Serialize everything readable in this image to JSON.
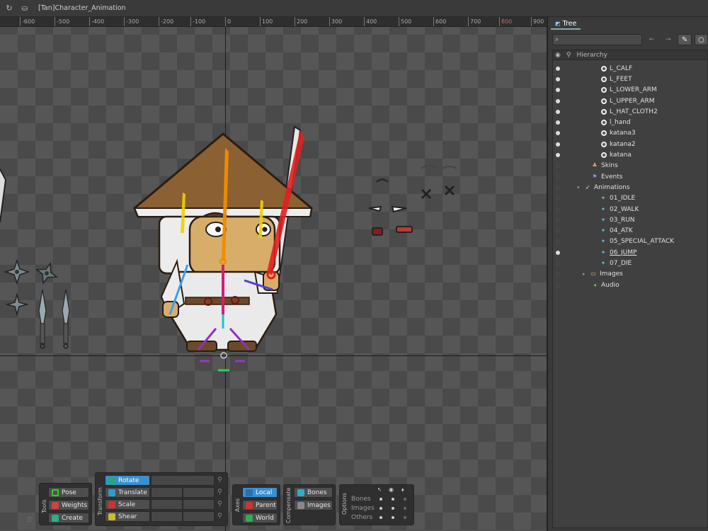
{
  "window": {
    "title": "[Tan]Character_Animation",
    "back_icon": "refresh-icon",
    "doc_icon": "document-icon"
  },
  "ruler": {
    "ticks": [
      "-600",
      "-500",
      "-400",
      "-300",
      "-200",
      "-100",
      "0",
      "100",
      "200",
      "300",
      "400",
      "500",
      "600",
      "700",
      "800",
      "900"
    ]
  },
  "panel": {
    "tab_label": "Tree",
    "search_placeholder": "",
    "header_label": "Hierarchy",
    "tree_items": [
      {
        "label": "L_CALF",
        "kind": "slot",
        "visible": true
      },
      {
        "label": "L_FEET",
        "kind": "slot",
        "visible": true
      },
      {
        "label": "L_LOWER_ARM",
        "kind": "slot",
        "visible": true
      },
      {
        "label": "L_UPPER_ARM",
        "kind": "slot",
        "visible": true
      },
      {
        "label": "L_HAT_CLOTH2",
        "kind": "slot",
        "visible": true
      },
      {
        "label": "l_hand",
        "kind": "slot",
        "visible": true
      },
      {
        "label": "katana3",
        "kind": "slot",
        "visible": true
      },
      {
        "label": "katana2",
        "kind": "slot",
        "visible": true
      },
      {
        "label": "katana",
        "kind": "slot",
        "visible": true
      },
      {
        "label": "Skins",
        "kind": "skins",
        "visible": false
      },
      {
        "label": "Events",
        "kind": "events",
        "visible": false
      },
      {
        "label": "Animations",
        "kind": "animations",
        "visible": false
      },
      {
        "label": "01_IDLE",
        "kind": "animation",
        "visible": false
      },
      {
        "label": "02_WALK",
        "kind": "animation",
        "visible": false
      },
      {
        "label": "03_RUN",
        "kind": "animation",
        "visible": false
      },
      {
        "label": "04_ATK",
        "kind": "animation",
        "visible": false
      },
      {
        "label": "05_SPECIAL_ATTACK",
        "kind": "animation",
        "visible": false
      },
      {
        "label": "06_JUMP",
        "kind": "animation",
        "visible": true
      },
      {
        "label": "07_DIE",
        "kind": "animation",
        "visible": false
      },
      {
        "label": "Images",
        "kind": "images",
        "visible": false
      },
      {
        "label": "Audio",
        "kind": "audio",
        "visible": false
      }
    ]
  },
  "toolbar": {
    "tools": {
      "label": "Tools",
      "pose": "Pose",
      "weights": "Weights",
      "create": "Create"
    },
    "transform": {
      "label": "Transform",
      "rotate": "Rotate",
      "translate": "Translate",
      "scale": "Scale",
      "shear": "Shear"
    },
    "axes": {
      "label": "Axes",
      "local": "Local",
      "parent": "Parent",
      "world": "World"
    },
    "compensate": {
      "label": "Compensate",
      "bones": "Bones",
      "images": "Images"
    },
    "options": {
      "label": "Options",
      "rows": [
        "Bones",
        "Images",
        "Others"
      ]
    }
  },
  "colors": {
    "accent": "#3a8fd0",
    "bone_red": "#e02020",
    "bone_orange": "#f08c00",
    "bone_yellow": "#f0d000"
  }
}
